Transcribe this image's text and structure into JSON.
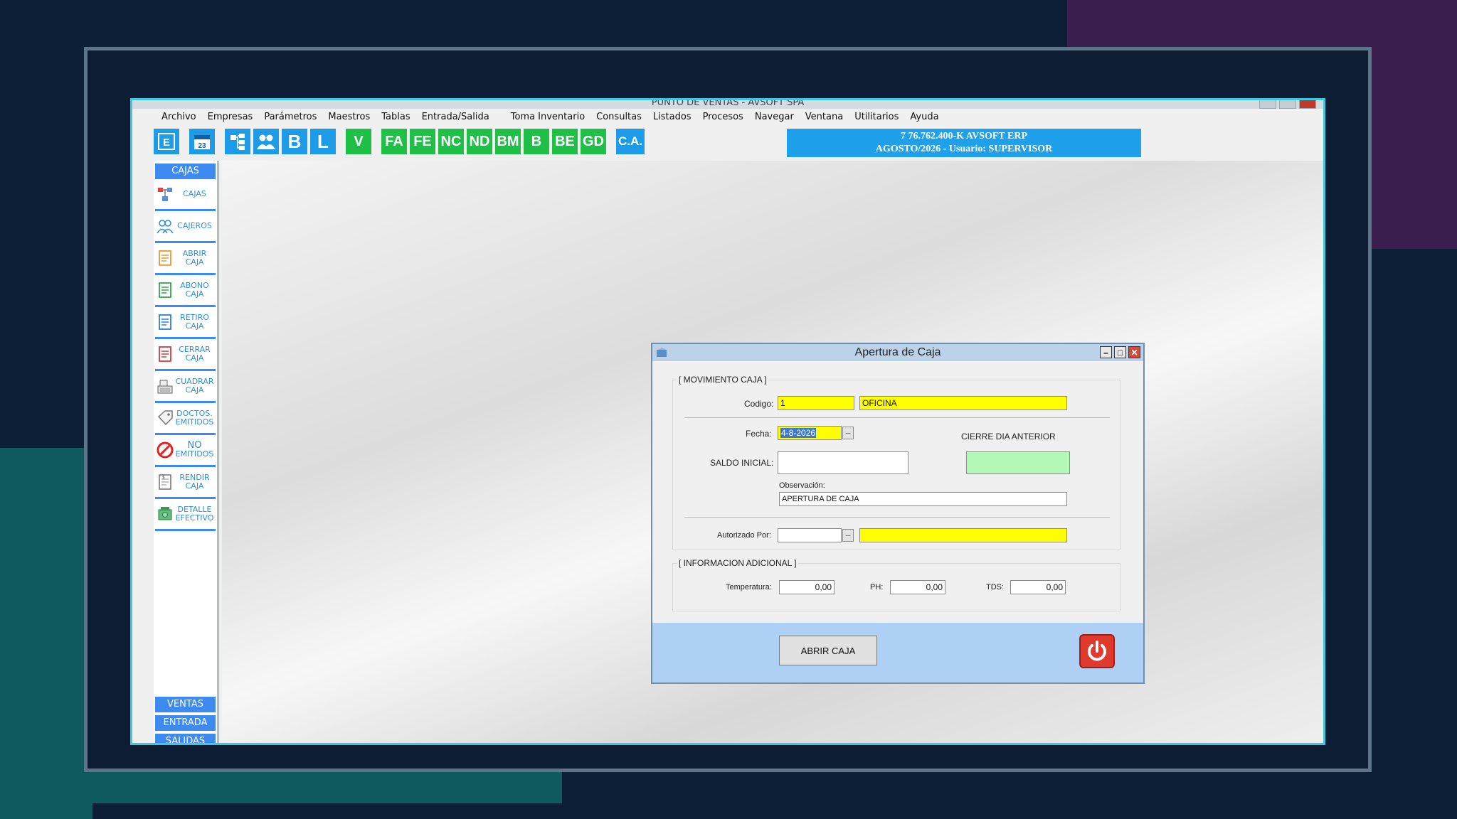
{
  "app": {
    "title": "PUNTO DE VENTAS - AVSOFT SPA",
    "menu": [
      "Archivo",
      "Empresas",
      "Parámetros",
      "Maestros",
      "Tablas",
      "Entrada/Salida",
      "Toma Inventario",
      "Consultas",
      "Listados",
      "Procesos",
      "Navegar",
      "Ventana",
      "Utilitarios",
      "Ayuda"
    ],
    "toolbar": {
      "blue_icons": [
        "e-icon",
        "calendar-icon",
        "org-icon",
        "users-icon"
      ],
      "buttons": [
        "B",
        "L",
        "V",
        "FA",
        "FE",
        "NC",
        "ND",
        "BM",
        "B",
        "BE",
        "GD",
        "C.A."
      ],
      "calendar_day": "23",
      "e_label": "E"
    },
    "banner": {
      "line1": "7 76.762.400-K AVSOFT ERP",
      "line2": "AGOSTO/2026  -  Usuario: SUPERVISOR",
      "color": "#1ea1ea"
    }
  },
  "sidebar": {
    "header": "CAJAS",
    "items": [
      {
        "l1": "CAJAS",
        "l2": ""
      },
      {
        "l1": "CAJEROS",
        "l2": ""
      },
      {
        "l1": "ABRIR",
        "l2": "CAJA"
      },
      {
        "l1": "ABONO",
        "l2": "CAJA"
      },
      {
        "l1": "RETIRO",
        "l2": "CAJA"
      },
      {
        "l1": "CERRAR",
        "l2": "CAJA"
      },
      {
        "l1": "CUADRAR",
        "l2": "CAJA"
      },
      {
        "l1": "DOCTOS.",
        "l2": "EMITIDOS"
      },
      {
        "l1": "NO",
        "l2": "EMITIDOS"
      },
      {
        "l1": "RENDIR",
        "l2": "CAJA"
      },
      {
        "l1": "DETALLE",
        "l2": "EFECTIVO"
      }
    ],
    "bottom": [
      "VENTAS",
      "ENTRADA",
      "SALIDAS"
    ],
    "accent": "#3d8af0"
  },
  "dialog": {
    "title": "Apertura de Caja",
    "group1": "[ MOVIMIENTO CAJA ]",
    "codigo_label": "Codigo:",
    "codigo_value": "1",
    "codigo_name": "OFICINA",
    "fecha_label": "Fecha:",
    "fecha_value": "4-8-2026",
    "cierre_label": "CIERRE DIA ANTERIOR",
    "saldo_label": "SALDO INICIAL:",
    "saldo_value": "",
    "cierre_value": "",
    "obs_label": "Observación:",
    "obs_value": "APERTURA DE CAJA",
    "autorizado_label": "Autorizado Por:",
    "autorizado_value": "",
    "autorizado_name": "",
    "group2": "[ INFORMACION ADICIONAL ]",
    "temp_label": "Temperatura:",
    "temp_value": "0,00",
    "ph_label": "PH:",
    "ph_value": "0,00",
    "tds_label": "TDS:",
    "tds_value": "0,00",
    "open_button": "ABRIR CAJA",
    "dots": "..."
  }
}
